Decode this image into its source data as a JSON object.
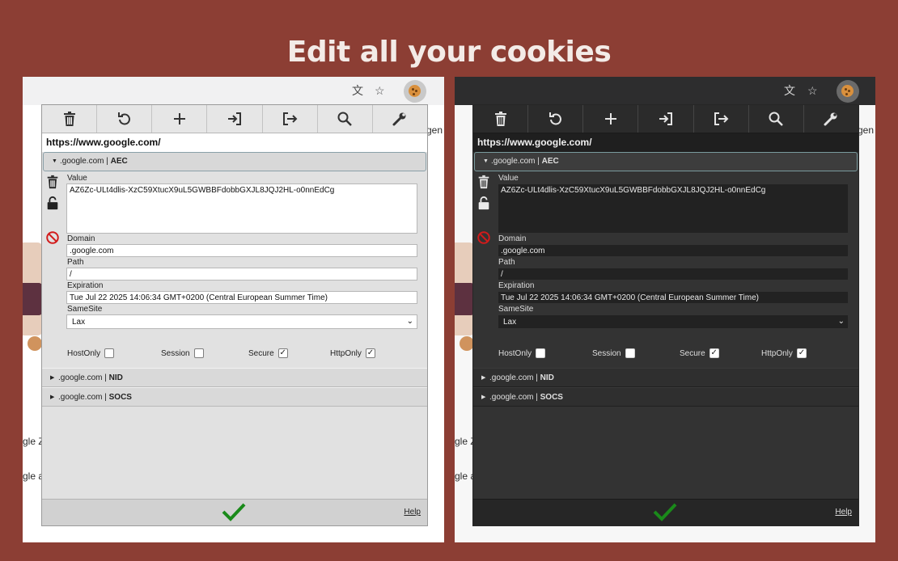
{
  "headline": "Edit all your cookies",
  "browser": {
    "translate_icon": "translate-icon",
    "star_icon": "star-icon",
    "extension_icon": "cookie-icon"
  },
  "background_page": {
    "peek_top": "ngen",
    "peek_google": "gle Z",
    "peek_bottom": "gle a"
  },
  "popup": {
    "toolbar": [
      {
        "name": "delete-all",
        "icon": "trash-icon"
      },
      {
        "name": "refresh",
        "icon": "refresh-icon"
      },
      {
        "name": "add",
        "icon": "plus-icon"
      },
      {
        "name": "import",
        "icon": "import-icon"
      },
      {
        "name": "export",
        "icon": "export-icon"
      },
      {
        "name": "search",
        "icon": "search-icon"
      },
      {
        "name": "options",
        "icon": "wrench-icon"
      }
    ],
    "url": "https://www.google.com/",
    "expanded_cookie": {
      "domain_label": ".google.com | ",
      "name": "AEC",
      "value_label": "Value",
      "value": "AZ6Zc-ULt4dlis-XzC59XtucX9uL5GWBBFdobbGXJL8JQJ2HL-o0nnEdCg",
      "domain_field_label": "Domain",
      "domain": ".google.com",
      "path_label": "Path",
      "path": "/",
      "expiration_label": "Expiration",
      "expiration": "Tue Jul 22 2025 14:06:34 GMT+0200 (Central European Summer Time)",
      "samesite_label": "SameSite",
      "samesite": "Lax",
      "flags": {
        "hostonly_label": "HostOnly",
        "hostonly": false,
        "session_label": "Session",
        "session": false,
        "secure_label": "Secure",
        "secure": true,
        "httponly_label": "HttpOnly",
        "httponly": true
      }
    },
    "collapsed_cookies": [
      {
        "domain": ".google.com | ",
        "name": "NID"
      },
      {
        "domain": ".google.com | ",
        "name": "SOCS"
      }
    ],
    "help_label": "Help",
    "accent_color": "#1a8a1a"
  }
}
